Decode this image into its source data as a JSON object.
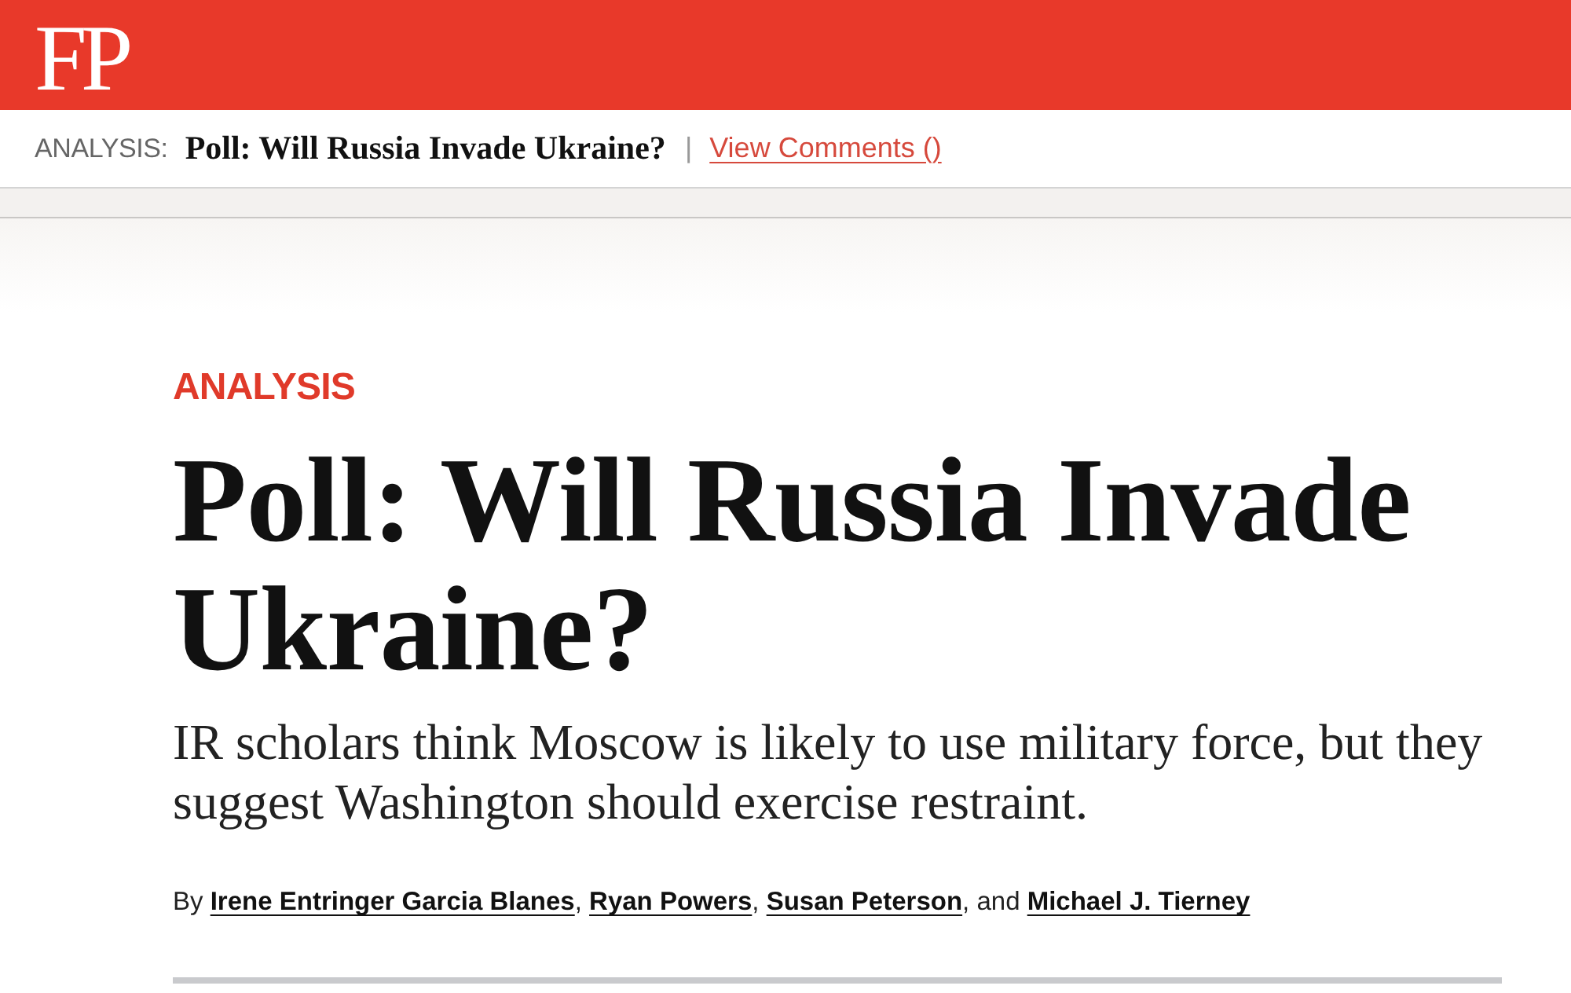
{
  "header": {
    "logo": "FP"
  },
  "sticky_bar": {
    "label": "ANALYSIS:",
    "title": "Poll: Will Russia Invade Ukraine?",
    "separator": "|",
    "comments_link": "View Comments ()"
  },
  "article": {
    "category": "ANALYSIS",
    "headline": "Poll: Will Russia Invade Ukraine?",
    "deck": "IR scholars think Moscow is likely to use military force, but they suggest Washington should exercise restraint.",
    "byline": [
      {
        "kind": "text",
        "text": "By "
      },
      {
        "kind": "link",
        "text": "Irene Entringer Garcia Blanes"
      },
      {
        "kind": "text",
        "text": ", "
      },
      {
        "kind": "link",
        "text": "Ryan Powers"
      },
      {
        "kind": "text",
        "text": ", "
      },
      {
        "kind": "link",
        "text": "Susan Peterson"
      },
      {
        "kind": "text",
        "text": ", and "
      },
      {
        "kind": "link",
        "text": "Michael J. Tierney"
      }
    ]
  }
}
